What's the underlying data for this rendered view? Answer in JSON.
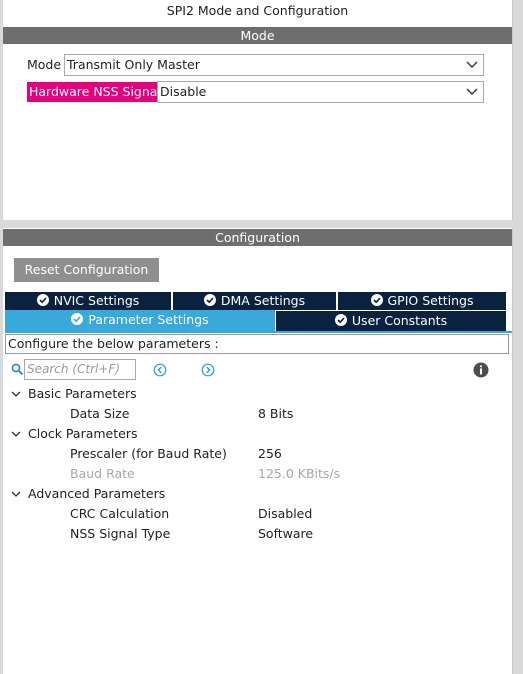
{
  "window": {
    "title": "SPI2 Mode and Configuration"
  },
  "mode_section": {
    "header": "Mode",
    "mode_label": "Mode",
    "mode_value": "Transmit Only Master",
    "nss_label": "Hardware NSS Signal",
    "nss_value": "Disable"
  },
  "config_section": {
    "header": "Configuration",
    "reset_button": "Reset Configuration",
    "tabs": [
      {
        "label": "NVIC Settings",
        "active": false
      },
      {
        "label": "DMA Settings",
        "active": false
      },
      {
        "label": "GPIO Settings",
        "active": false
      },
      {
        "label": "Parameter Settings",
        "active": true
      },
      {
        "label": "User Constants",
        "active": false
      }
    ],
    "description": "Configure the below parameters :",
    "search_placeholder": "Search (Ctrl+F)",
    "groups": [
      {
        "label": "Basic Parameters",
        "params": [
          {
            "name": "Data Size",
            "value": "8 Bits",
            "disabled": false
          }
        ]
      },
      {
        "label": "Clock Parameters",
        "params": [
          {
            "name": "Prescaler (for Baud Rate)",
            "value": "256",
            "disabled": false
          },
          {
            "name": "Baud Rate",
            "value": "125.0 KBits/s",
            "disabled": true
          }
        ]
      },
      {
        "label": "Advanced Parameters",
        "params": [
          {
            "name": "CRC Calculation",
            "value": "Disabled",
            "disabled": false
          },
          {
            "name": "NSS Signal Type",
            "value": "Software",
            "disabled": false
          }
        ]
      }
    ]
  },
  "colors": {
    "section_bar": "#6e6e6e",
    "highlight": "#e5007e",
    "tab_dark": "#0a2240",
    "tab_active": "#39a9dc",
    "reset_button": "#8f8f8f"
  },
  "icons": {
    "search": "search-icon",
    "prev": "circle-chevron-left-icon",
    "next": "circle-chevron-right-icon",
    "info": "info-icon",
    "tab_check": "check-circle-icon",
    "expand": "chevron-down-icon",
    "dropdown": "chevron-down-icon"
  }
}
